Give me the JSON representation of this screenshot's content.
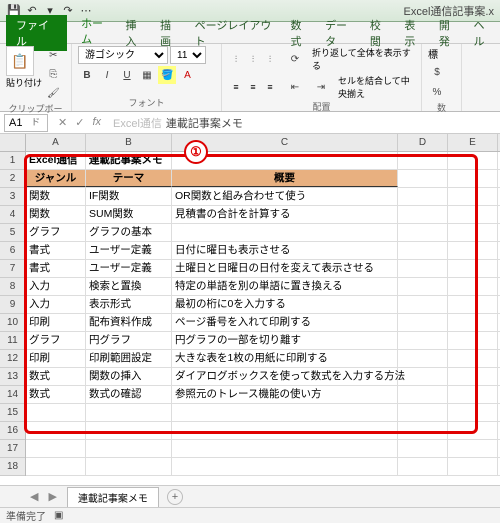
{
  "titlebar": {
    "app_title": "Excel通信記事案.x",
    "save_icon": "💾",
    "undo_icon": "↶",
    "redo_icon": "↷",
    "dropdown_icon": "▾"
  },
  "menu": {
    "file": "ファイル",
    "home": "ホーム",
    "insert": "挿入",
    "draw": "描画",
    "page_layout": "ページレイアウト",
    "formulas": "数式",
    "data": "データ",
    "review": "校閲",
    "view": "表示",
    "developer": "開発",
    "help": "ヘル"
  },
  "ribbon": {
    "clipboard": {
      "label": "クリップボード",
      "paste": "貼り付け",
      "cut_icon": "✂",
      "copy_icon": "⎘",
      "brush_icon": "🖌"
    },
    "font": {
      "label": "フォント",
      "name": "游ゴシック",
      "size": "11",
      "bold": "B",
      "italic": "I",
      "underline": "U"
    },
    "align": {
      "label": "配置",
      "wrap": "折り返して全体を表示する",
      "merge": "セルを結合して中央揃え"
    },
    "number": {
      "label": "数",
      "std": "標",
      "pct": "%"
    }
  },
  "formula_bar": {
    "cell_ref": "A1",
    "fx": "fx",
    "text_a": "Excel通信",
    "text_b": "連載記事案メモ"
  },
  "callout": "①",
  "cols": [
    "A",
    "B",
    "C",
    "D",
    "E"
  ],
  "cell_title_a": "Excel通信",
  "cell_title_b": "連載記事案メモ",
  "headers": {
    "genre": "ジャンル",
    "theme": "テーマ",
    "summary": "概要"
  },
  "rows": [
    {
      "a": "関数",
      "b": "IF関数",
      "c": "OR関数と組み合わせて使う"
    },
    {
      "a": "関数",
      "b": "SUM関数",
      "c": "見積書の合計を計算する"
    },
    {
      "a": "グラフ",
      "b": "グラフの基本",
      "c": ""
    },
    {
      "a": "書式",
      "b": "ユーザー定義",
      "c": "日付に曜日も表示させる"
    },
    {
      "a": "書式",
      "b": "ユーザー定義",
      "c": "土曜日と日曜日の日付を変えて表示させる"
    },
    {
      "a": "入力",
      "b": "検索と置換",
      "c": "特定の単語を別の単語に置き換える"
    },
    {
      "a": "入力",
      "b": "表示形式",
      "c": "最初の桁に0を入力する"
    },
    {
      "a": "印刷",
      "b": "配布資料作成",
      "c": "ページ番号を入れて印刷する"
    },
    {
      "a": "グラフ",
      "b": "円グラフ",
      "c": "円グラフの一部を切り離す"
    },
    {
      "a": "印刷",
      "b": "印刷範囲設定",
      "c": "大きな表を1枚の用紙に印刷する"
    },
    {
      "a": "数式",
      "b": "関数の挿入",
      "c": "ダイアログボックスを使って数式を入力する方法"
    },
    {
      "a": "数式",
      "b": "数式の確認",
      "c": "参照元のトレース機能の使い方"
    }
  ],
  "sheet_tab": "連載記事案メモ",
  "status": "準備完了"
}
